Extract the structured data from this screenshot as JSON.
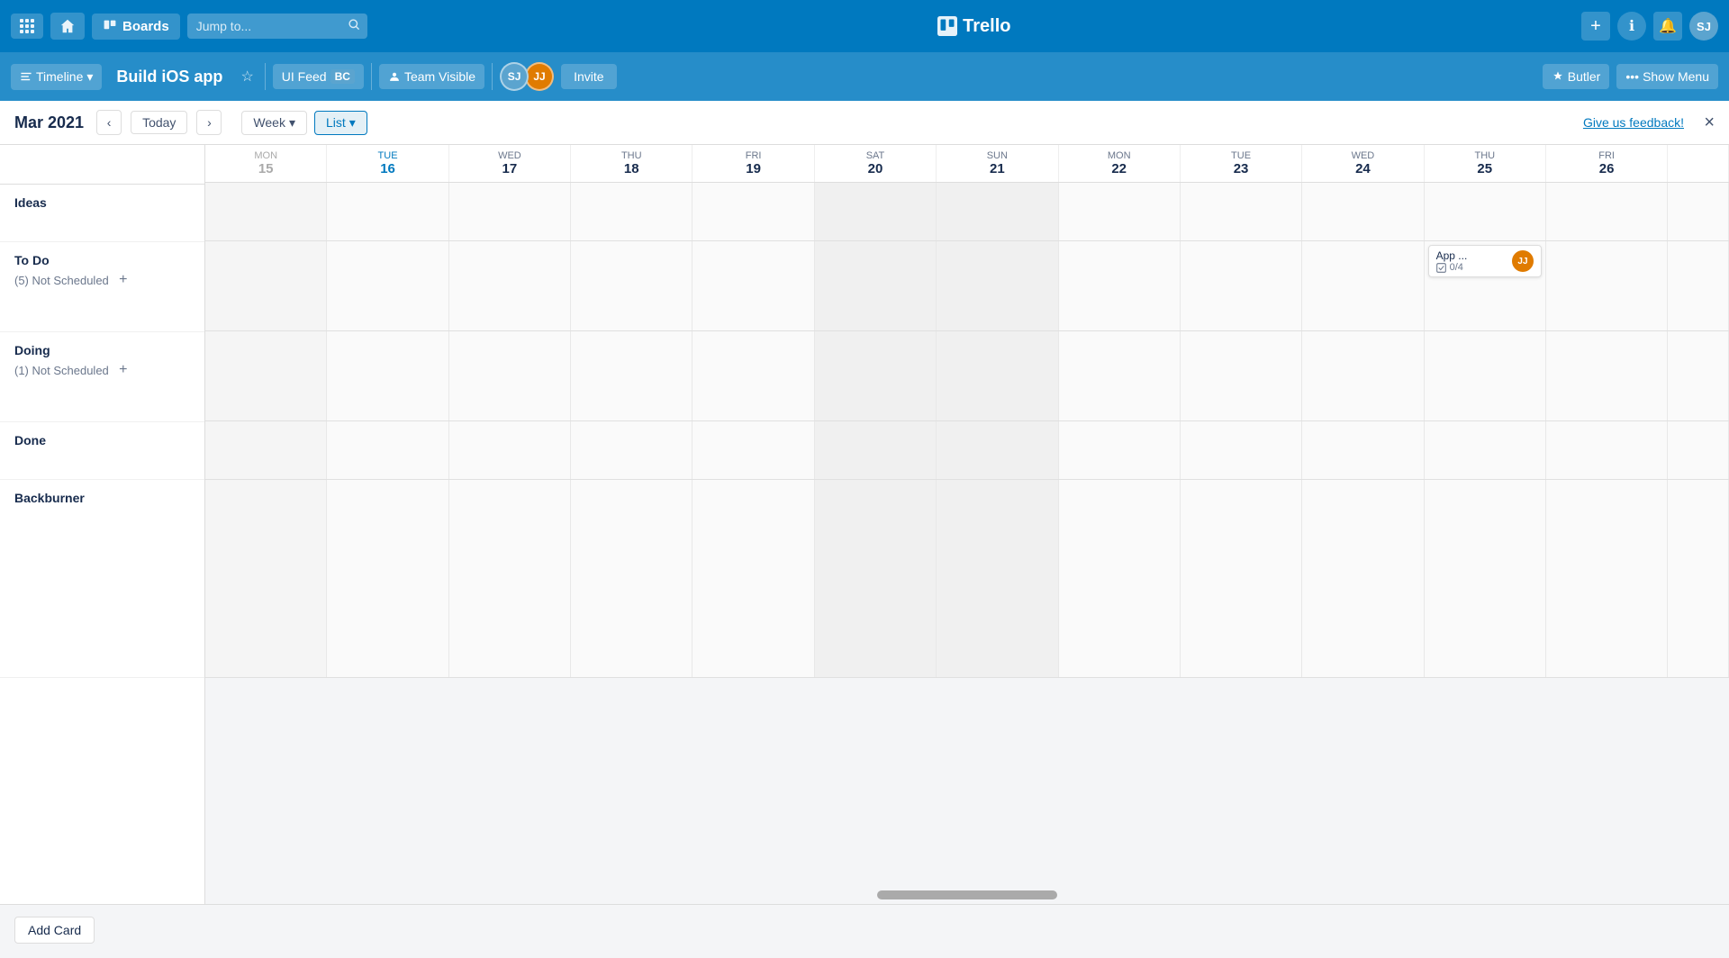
{
  "topNav": {
    "boardsLabel": "Boards",
    "searchPlaceholder": "Jump to...",
    "trelloLabel": "Trello",
    "addTooltip": "Create",
    "infoTooltip": "Information",
    "notifTooltip": "Notifications",
    "avatarLabel": "SJ"
  },
  "boardNav": {
    "timelineLabel": "Timeline",
    "boardTitle": "Build iOS app",
    "uiFeedLabel": "UI Feed",
    "uiFeedBadge": "BC",
    "teamVisibleLabel": "Team Visible",
    "inviteLabel": "Invite",
    "butlerLabel": "Butler",
    "showMenuLabel": "Show Menu",
    "avatars": [
      {
        "initials": "SJ",
        "color": "#5ba4cf"
      },
      {
        "initials": "JJ",
        "color": "#e07b00"
      }
    ]
  },
  "calendar": {
    "month": "Mar 2021",
    "todayLabel": "Today",
    "weekLabel": "Week",
    "listLabel": "List",
    "feedbackLabel": "Give us feedback!",
    "closeLabel": "×",
    "dates": [
      {
        "dayName": "MON",
        "dayNum": "15",
        "faded": true,
        "weekend": false
      },
      {
        "dayName": "TUE",
        "dayNum": "16",
        "faded": false,
        "weekend": false
      },
      {
        "dayName": "WED",
        "dayNum": "17",
        "faded": false,
        "weekend": false
      },
      {
        "dayName": "THU",
        "dayNum": "18",
        "faded": false,
        "weekend": false
      },
      {
        "dayName": "FRI",
        "dayNum": "19",
        "faded": false,
        "weekend": false
      },
      {
        "dayName": "SAT",
        "dayNum": "20",
        "faded": false,
        "weekend": true
      },
      {
        "dayName": "SUN",
        "dayNum": "21",
        "faded": false,
        "weekend": true
      },
      {
        "dayName": "MON",
        "dayNum": "22",
        "faded": false,
        "weekend": false
      },
      {
        "dayName": "TUE",
        "dayNum": "23",
        "faded": false,
        "weekend": false
      },
      {
        "dayName": "WED",
        "dayNum": "24",
        "faded": false,
        "weekend": false
      },
      {
        "dayName": "THU",
        "dayNum": "25",
        "faded": false,
        "weekend": false
      },
      {
        "dayName": "FRI",
        "dayNum": "26",
        "faded": false,
        "weekend": false
      }
    ],
    "lists": [
      {
        "name": "Ideas",
        "notScheduled": null
      },
      {
        "name": "To Do",
        "notScheduled": "(5) Not Scheduled"
      },
      {
        "name": "Doing",
        "notScheduled": "(1) Not Scheduled"
      },
      {
        "name": "Done",
        "notScheduled": null
      },
      {
        "name": "Backburner",
        "notScheduled": null
      }
    ],
    "cards": [
      {
        "listIndex": 1,
        "dateIndex": 10,
        "title": "App ...",
        "checkCount": "0/4",
        "avatarInitials": "JJ",
        "avatarColor": "#e07b00"
      }
    ],
    "addCardLabel": "Add Card"
  }
}
